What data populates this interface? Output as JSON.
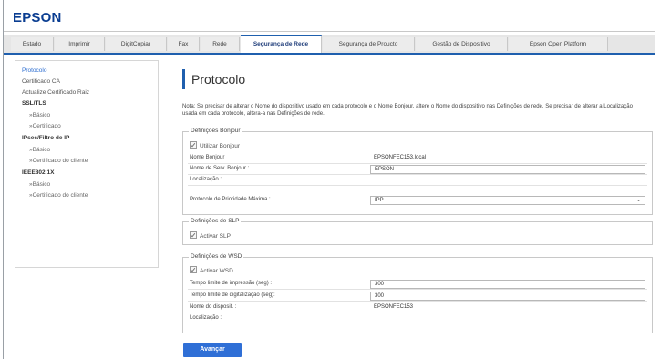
{
  "brand": {
    "logo": "EPSON"
  },
  "tabs": [
    {
      "label": "Estado"
    },
    {
      "label": "Imprimir"
    },
    {
      "label": "DigitCopiar"
    },
    {
      "label": "Fax"
    },
    {
      "label": "Rede"
    },
    {
      "label": "Segurança de Rede"
    },
    {
      "label": "Segurança de Proucto"
    },
    {
      "label": "Gestão de Dispositivo"
    },
    {
      "label": "Epson Open Platform"
    }
  ],
  "sidebar": {
    "items": [
      {
        "label": "Protocolo"
      },
      {
        "label": "Certificado CA"
      },
      {
        "label": "Actualize Certificado Raiz"
      },
      {
        "label": "SSL/TLS"
      },
      {
        "label": "»Básico"
      },
      {
        "label": "»Certificado"
      },
      {
        "label": "IPsec/Filtro de IP"
      },
      {
        "label": "»Básico"
      },
      {
        "label": "»Certificado do cliente"
      },
      {
        "label": "IEEE802.1X"
      },
      {
        "label": "»Básico"
      },
      {
        "label": "»Certificado do cliente"
      }
    ]
  },
  "page": {
    "title": "Protocolo",
    "note": "Nota: Se precisar de alterar o Nome do dispositivo usado em cada protocolo e o Nome Bonjour, altere o Nome do dispositivo nas Definições de rede. Se precisar de alterar a Localização usada em cada protocolo, altera-a nas Definições de rede."
  },
  "bonjour": {
    "legend": "Definições Bonjour",
    "checkbox_label": "Utilizar Bonjour",
    "rows": [
      {
        "label": "Nome Bonjour",
        "value": "EPSONFEC153.local"
      },
      {
        "label": "Nome de Serv. Bonjour :",
        "value": "EPSON"
      },
      {
        "label": "Localização :",
        "value": ""
      },
      {
        "label": "Protocolo de Prioridade Máxima :",
        "value": "IPP"
      }
    ]
  },
  "slp": {
    "legend": "Definições de SLP",
    "checkbox_label": "Activar SLP"
  },
  "wsd": {
    "legend": "Definições de WSD",
    "checkbox_label": "Activar WSD",
    "rows": [
      {
        "label": "Tempo limite de impressão (seg) :",
        "value": "300"
      },
      {
        "label": "Tempo limite de digitalização (seg):",
        "value": "300"
      },
      {
        "label": "Nome do disposit. :",
        "value": "EPSONFEC153"
      },
      {
        "label": "Localização :",
        "value": ""
      }
    ]
  },
  "actions": {
    "next_label": "Avançar"
  },
  "colors": {
    "brand_blue": "#0a3d91",
    "accent": "#1f5fae",
    "button": "#2f6fd6"
  }
}
